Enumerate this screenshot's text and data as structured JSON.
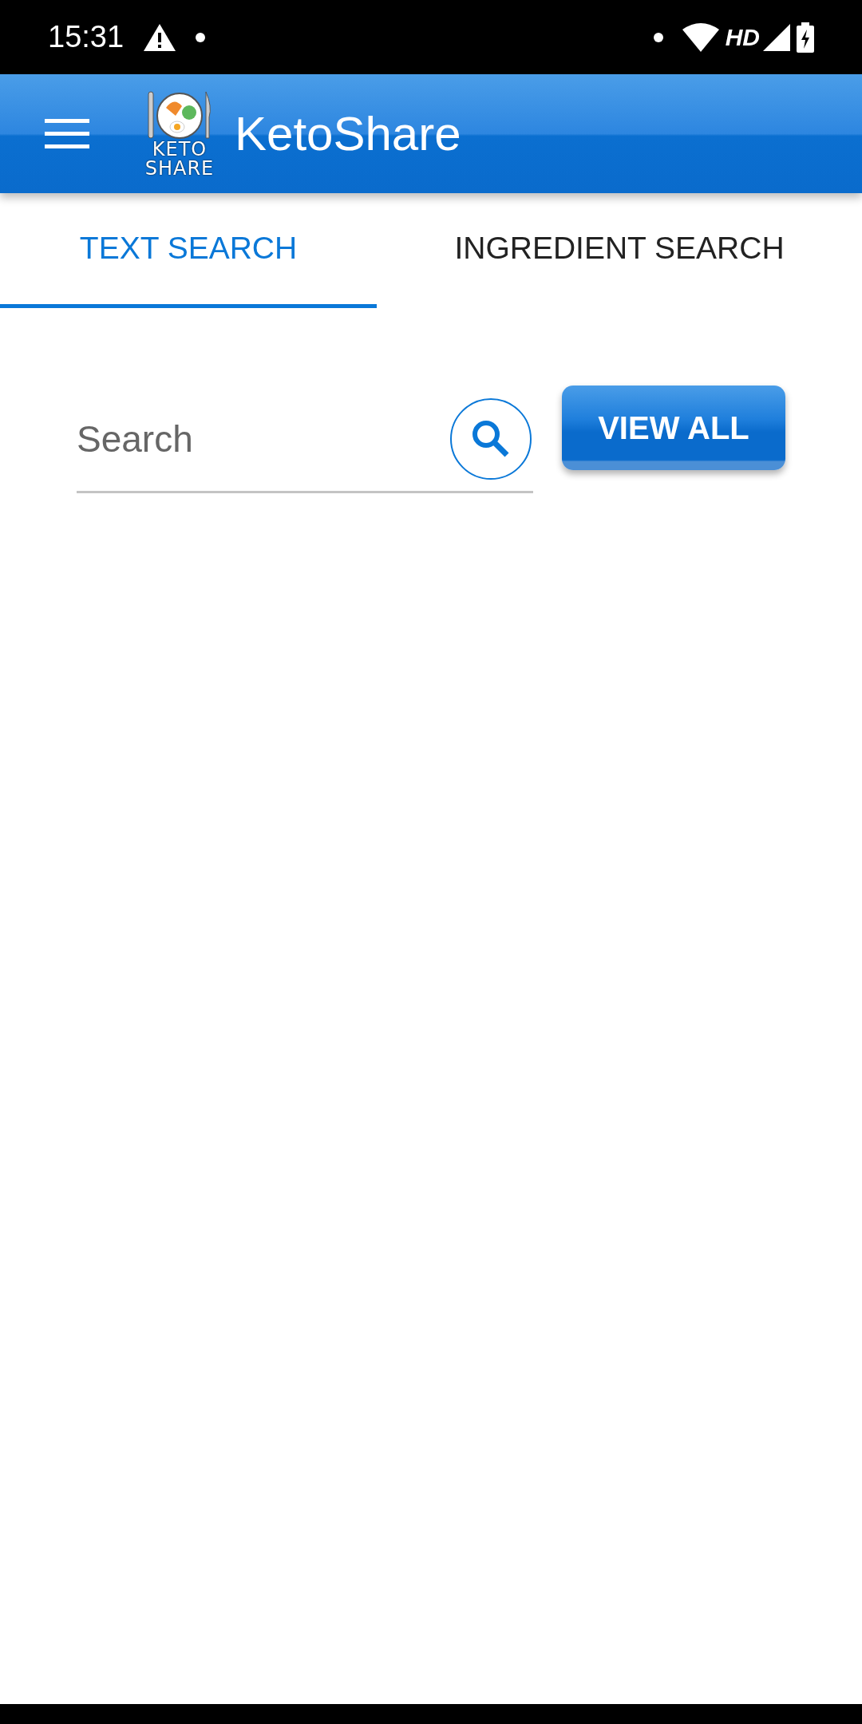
{
  "status_bar": {
    "time": "15:31",
    "network_label": "HD"
  },
  "app_bar": {
    "logo_lines": [
      "KETO",
      "SHARE"
    ],
    "title": "KetoShare"
  },
  "tabs": [
    {
      "label": "TEXT SEARCH",
      "selected": true
    },
    {
      "label": "INGREDIENT SEARCH",
      "selected": false
    }
  ],
  "search": {
    "placeholder": "Search"
  },
  "buttons": [
    "VIEW ALL"
  ]
}
